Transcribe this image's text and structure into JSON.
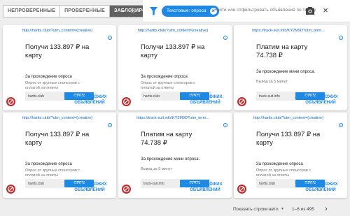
{
  "toolbar": {
    "tabs": [
      "НЕПРОВЕРЕННЫЕ",
      "ПРОВЕРЕННЫЕ",
      "ЗАБЛОКИРОВАНО"
    ],
    "help": "?"
  },
  "search": {
    "chip_label": "Текстовые: опроса",
    "chip_remove": "×",
    "text": "Найти или отфильтровать объявления по тексту",
    "close": "×"
  },
  "cards": [
    {
      "url": "http://hartts.club/?utm_content={creative}",
      "title": "Получи 133.897 ₽ на карту",
      "subtitle": "За прохождение опроса",
      "description": "Опрос от крупных спонсоров с оплатой за ответы",
      "domain": "hartts.club",
      "open": "OPEN",
      "similar": "ПОИСК СХОЖИХ ОБЪЯВЛЕНИЙ"
    },
    {
      "url": "http://hartts.club/?utm_content={creative}",
      "title": "Получи 133.897 ₽ на карту",
      "subtitle": "За прохождение опроса",
      "description": "Опрос от крупных спонсоров с оплатой за ответы",
      "domain": "hartts.club",
      "open": "OPEN",
      "similar": "ПОИСК СХОЖИХ ОБЪЯВЛЕНИЙ"
    },
    {
      "url": "https://track-suit.info/KY2M9D?utm_term...",
      "title": "Платим на карту 74.738 ₽",
      "subtitle": "За прохождение мини опроса.",
      "description": "Вывод за 5 минут",
      "domain": "track-suit.info",
      "open": "OPEN",
      "similar": "ПОИСК СХОЖИХ ОБЪЯВЛЕНИЙ"
    },
    {
      "url": "http://hartts.club/?utm_content={creative}",
      "title": "Получи 133.897 ₽ на карту",
      "subtitle": "За прохождение опроса",
      "description": "Опрос от крупных спонсоров с оплатой за ответы",
      "domain": "hartts.club",
      "open": "OPEN",
      "similar": "ПОИСК СХОЖИХ ОБЪЯВЛЕНИЙ"
    },
    {
      "url": "https://track-suit.info/KY2M9D?utm_term...",
      "title": "Платим на карту 74.738 ₽",
      "subtitle": "За прохождение мини опроса.",
      "description": "Вывод за 5 минут",
      "domain": "track-suit.info",
      "open": "OPEN",
      "similar": "ПОИСК СХОЖИХ ОБЪЯВЛЕНИЙ"
    },
    {
      "url": "http://hartts.club/?utm_content={creative}",
      "title": "Получи 133.897 ₽ на карту",
      "subtitle": "За прохождение опроса",
      "description": "Опрос от крупных спонсоров с оплатой за ответы",
      "domain": "hartts.club",
      "open": "OPEN",
      "similar": "ПОИСК СХОЖИХ ОБЪЯВЛЕНИЙ"
    }
  ],
  "pagination": {
    "rows_label": "Показать строки:",
    "rows_value": "авто",
    "range": "1–6 из 495",
    "prev": "‹",
    "next": "›"
  },
  "colors": {
    "accent": "#1e88e5",
    "block": "#c62828",
    "active_tab": "#616161"
  },
  "icons": [
    "help-icon",
    "filter-icon",
    "camera-icon",
    "close-icon",
    "info-icon",
    "block-icon"
  ]
}
